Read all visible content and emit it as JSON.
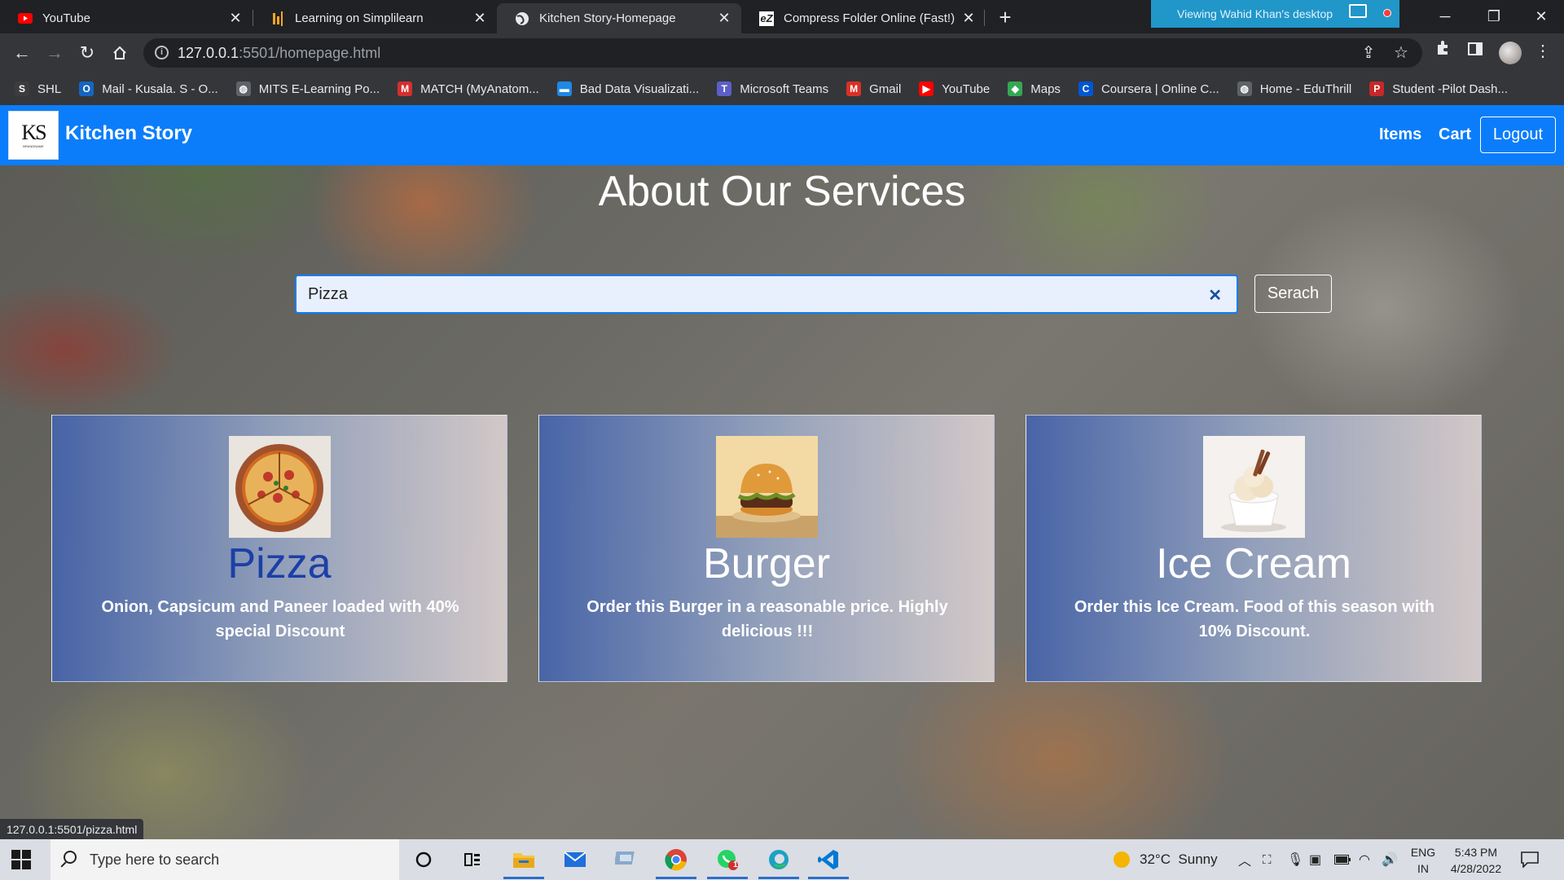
{
  "browser": {
    "tabs": [
      {
        "title": "YouTube",
        "icon": "youtube-icon",
        "active": false
      },
      {
        "title": "Learning on Simplilearn",
        "icon": "simplilearn-icon",
        "active": false
      },
      {
        "title": "Kitchen Story-Homepage",
        "icon": "globe-icon",
        "active": true
      },
      {
        "title": "Compress Folder Online (Fast!)",
        "icon": "ezyzip-icon",
        "active": false
      }
    ],
    "viewing_banner": "Viewing Wahid Khan's desktop",
    "address": {
      "host": "127.0.0.1",
      "path": ":5501/homepage.html"
    },
    "bookmarks": [
      {
        "label": "SHL",
        "icon": "shl-icon",
        "color": "#3c3c3c",
        "glyph": "S"
      },
      {
        "label": "Mail - Kusala. S - O...",
        "icon": "outlook-icon",
        "color": "#1565c0",
        "glyph": "O"
      },
      {
        "label": "MITS E-Learning Po...",
        "icon": "globe-icon",
        "color": "#5f6368",
        "glyph": "◍"
      },
      {
        "label": "MATCH (MyAnatom...",
        "icon": "match-icon",
        "color": "#d32f2f",
        "glyph": "M"
      },
      {
        "label": "Bad Data Visualizati...",
        "icon": "bookmark-icon",
        "color": "#1e88e5",
        "glyph": "▬"
      },
      {
        "label": "Microsoft Teams",
        "icon": "teams-icon",
        "color": "#5b5fc7",
        "glyph": "T"
      },
      {
        "label": "Gmail",
        "icon": "gmail-icon",
        "color": "#d93025",
        "glyph": "M"
      },
      {
        "label": "YouTube",
        "icon": "youtube-icon",
        "color": "#ff0000",
        "glyph": "▶"
      },
      {
        "label": "Maps",
        "icon": "maps-icon",
        "color": "#34a853",
        "glyph": "◆"
      },
      {
        "label": "Coursera | Online C...",
        "icon": "coursera-icon",
        "color": "#0056d2",
        "glyph": "C"
      },
      {
        "label": "Home - EduThrill",
        "icon": "eduthrill-icon",
        "color": "#5f6368",
        "glyph": "◍"
      },
      {
        "label": "Student -Pilot Dash...",
        "icon": "pilot-icon",
        "color": "#c62828",
        "glyph": "P"
      }
    ],
    "status_url": "127.0.0.1:5501/pizza.html"
  },
  "site": {
    "logo_text": "KS",
    "logo_subtext": "BRANDNAME",
    "brand": "Kitchen Story",
    "nav": {
      "items": "Items",
      "cart": "Cart",
      "logout": "Logout"
    },
    "hero_title": "About Our Services",
    "search": {
      "value": "Pizza",
      "button": "Serach"
    },
    "cards": [
      {
        "name": "Pizza",
        "description": "Onion, Capsicum and Paneer loaded with 40% special Discount",
        "name_color": "#1c3fa8",
        "image": "pizza-image"
      },
      {
        "name": "Burger",
        "description": "Order this Burger in a reasonable price. Highly delicious !!!",
        "name_color": "#ffffff",
        "image": "burger-image"
      },
      {
        "name": "Ice Cream",
        "description": "Order this Ice Cream. Food of this season with 10% Discount.",
        "name_color": "#ffffff",
        "image": "ice-cream-image"
      }
    ]
  },
  "taskbar": {
    "search_placeholder": "Type here to search",
    "weather": "32°C  Sunny",
    "language": "ENG",
    "region": "IN",
    "time": "5:43 PM",
    "date": "4/28/2022",
    "whatsapp_badge": "1"
  }
}
